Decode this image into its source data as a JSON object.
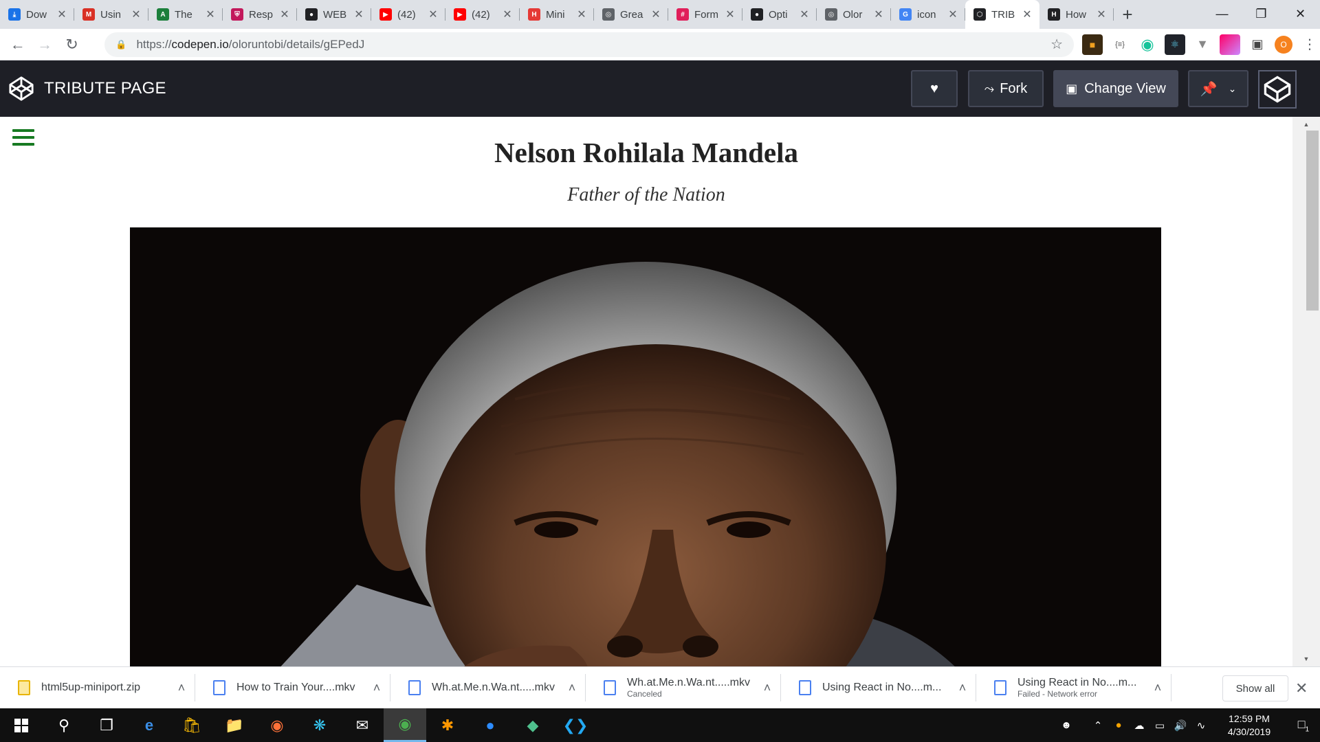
{
  "browser": {
    "tabs": [
      {
        "title": "Dow",
        "favicon": "download-icon",
        "color": "#1a73e8",
        "active": false
      },
      {
        "title": "Usin",
        "favicon": "gmail-icon",
        "color": "#d93025",
        "active": false
      },
      {
        "title": "The",
        "favicon": "book-icon",
        "color": "#1b7f3b",
        "active": false
      },
      {
        "title": "Resp",
        "favicon": "shield-icon",
        "color": "#c2185b",
        "active": false
      },
      {
        "title": "WEB",
        "favicon": "github-icon",
        "color": "#202124",
        "active": false
      },
      {
        "title": "(42)",
        "favicon": "youtube-icon",
        "color": "#ff0000",
        "active": false
      },
      {
        "title": "(42)",
        "favicon": "youtube-icon",
        "color": "#ff0000",
        "active": false
      },
      {
        "title": "Mini",
        "favicon": "hsu-icon",
        "color": "#e53935",
        "active": false
      },
      {
        "title": "Grea",
        "favicon": "globe-icon",
        "color": "#5f6368",
        "active": false
      },
      {
        "title": "Form",
        "favicon": "slack-icon",
        "color": "#e01e5a",
        "active": false
      },
      {
        "title": "Opti",
        "favicon": "github-icon",
        "color": "#202124",
        "active": false
      },
      {
        "title": "Olor",
        "favicon": "globe-icon",
        "color": "#5f6368",
        "active": false
      },
      {
        "title": "icon",
        "favicon": "google-icon",
        "color": "#4285f4",
        "active": false
      },
      {
        "title": "TRIB",
        "favicon": "codepen-icon",
        "color": "#202124",
        "active": true
      },
      {
        "title": "How",
        "favicon": "htg-icon",
        "color": "#202124",
        "active": false
      }
    ],
    "url": {
      "protocol": "https://",
      "host": "codepen.io",
      "path": "/oloruntobi/details/gEPedJ"
    },
    "profile_initial": "O"
  },
  "codepen": {
    "title": "TRIBUTE PAGE",
    "fork_label": "Fork",
    "change_view_label": "Change View"
  },
  "page": {
    "title": "Nelson Rohilala Mandela",
    "subtitle": "Father of the Nation"
  },
  "downloads": {
    "items": [
      {
        "name": "html5up-miniport.zip",
        "status": "",
        "type": "zip"
      },
      {
        "name": "How to Train Your....mkv",
        "status": "",
        "type": "video"
      },
      {
        "name": "Wh.at.Me.n.Wa.nt.....mkv",
        "status": "",
        "type": "video"
      },
      {
        "name": "Wh.at.Me.n.Wa.nt.....mkv",
        "status": "Canceled",
        "type": "video"
      },
      {
        "name": "Using React in No....m...",
        "status": "",
        "type": "video"
      },
      {
        "name": "Using React in No....m...",
        "status": "Failed - Network error",
        "type": "video"
      }
    ],
    "show_all_label": "Show all"
  },
  "taskbar": {
    "time": "12:59 PM",
    "date": "4/30/2019",
    "notification_count": "1"
  },
  "colors": {
    "codepen_header": "#1e1f26",
    "hamburger": "#177a22",
    "tab_strip": "#dee1e6"
  }
}
